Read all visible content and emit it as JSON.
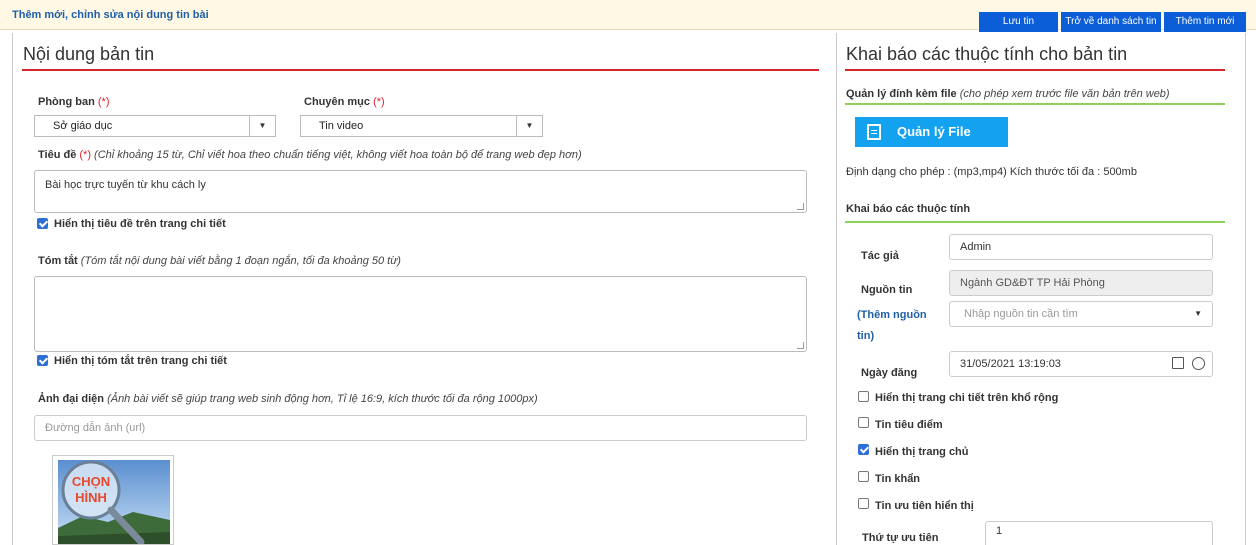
{
  "header": {
    "breadcrumb": "Thêm mới, chỉnh sửa nội dung tin bài",
    "buttons": {
      "save": "Lưu tin",
      "back": "Trở về danh sách tin",
      "new": "Thêm tin mới"
    }
  },
  "left": {
    "title": "Nội dung bản tin",
    "department": {
      "label": "Phòng ban",
      "required": "(*)",
      "value": "Sở giáo dục"
    },
    "category": {
      "label": "Chuyên mục",
      "required": "(*)",
      "value": "Tin video"
    },
    "headline": {
      "label": "Tiêu đề",
      "required": "(*)",
      "hint": "(Chỉ khoảng 15 từ, Chỉ viết hoa theo chuẩn tiếng việt, không viết hoa toàn bộ để trang web đẹp hơn)",
      "value": "Bài học trực tuyến từ khu cách ly"
    },
    "show_headline": {
      "label": "Hiển thị tiêu đề trên trang chi tiết",
      "checked": true
    },
    "summary": {
      "label": "Tóm tắt",
      "hint": "(Tóm tắt nội dung bài viết bằng 1 đoạn ngắn, tối đa khoảng 50 từ)",
      "value": ""
    },
    "show_summary": {
      "label": "Hiển thị tóm tắt trên trang chi tiết",
      "checked": true
    },
    "avatar": {
      "label": "Ảnh đại diện",
      "hint": "(Ảnh bài viết sẽ giúp trang web sinh động hơn, Tỉ lệ 16:9, kích thước tối đa rộng 1000px)",
      "placeholder": "Đường dẫn ảnh (url)",
      "pick_text_1": "CHỌN",
      "pick_text_2": "HÌNH"
    }
  },
  "right": {
    "title": "Khai báo các thuộc tính cho bản tin",
    "attachments": {
      "label": "Quản lý đính kèm file",
      "hint": "(cho phép xem trước file văn bản trên web)",
      "button": "Quản lý File",
      "formats": "Định dạng cho phép : (mp3,mp4) Kích thước tối đa : 500mb"
    },
    "attributes_title": "Khai báo các thuộc tính",
    "author": {
      "label": "Tác giả",
      "value": "Admin"
    },
    "source": {
      "label": "Nguồn tin",
      "value": "Ngành GD&ĐT TP Hải Phòng"
    },
    "add_source": {
      "label_1": "(Thêm nguồn",
      "label_2": "tin)",
      "placeholder": "Nhập nguồn tin cần tìm"
    },
    "date": {
      "label": "Ngày đăng",
      "value": "31/05/2021 13:19:03"
    },
    "options": [
      {
        "label": "Hiển thị trang chi tiết trên khổ rộng",
        "checked": false
      },
      {
        "label": "Tin tiêu điểm",
        "checked": false
      },
      {
        "label": "Hiển thị trang chủ",
        "checked": true
      },
      {
        "label": "Tin khẩn",
        "checked": false
      },
      {
        "label": "Tin ưu tiên hiển thị",
        "checked": false
      }
    ],
    "priority": {
      "label": "Thứ tự ưu tiên",
      "value": "1"
    }
  }
}
